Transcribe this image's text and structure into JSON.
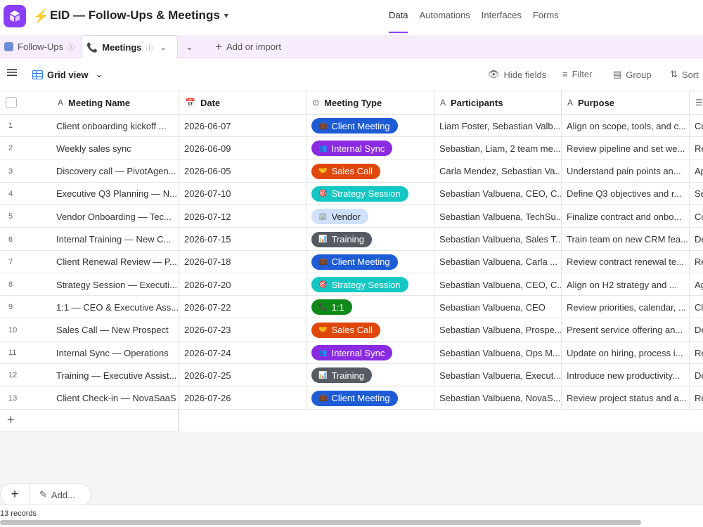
{
  "app": {
    "base_title": "EID — Follow-Ups & Meetings",
    "nav_tabs": [
      "Data",
      "Automations",
      "Interfaces",
      "Forms"
    ],
    "active_nav": "Data",
    "accent": "#8a3ffc"
  },
  "tables": {
    "items": [
      {
        "label": "Follow-Ups",
        "icon": "table-icon",
        "active": false
      },
      {
        "label": "Meetings",
        "icon": "phone-icon",
        "active": true
      }
    ],
    "add_label": "Add or import"
  },
  "toolbar": {
    "view_name": "Grid view",
    "hide_fields": "Hide fields",
    "filter": "Filter",
    "group": "Group",
    "sort": "Sort"
  },
  "columns": [
    {
      "label": "Meeting Name",
      "icon": "text-icon"
    },
    {
      "label": "Date",
      "icon": "calendar-icon"
    },
    {
      "label": "Meeting Type",
      "icon": "select-icon"
    },
    {
      "label": "Participants",
      "icon": "text-icon"
    },
    {
      "label": "Purpose",
      "icon": "text-icon"
    },
    {
      "label": "",
      "icon": "long-text-icon"
    }
  ],
  "meeting_types": {
    "Client Meeting": {
      "color": "#1e5cd6",
      "icon": "briefcase-icon",
      "glyph": "💼"
    },
    "Internal Sync": {
      "color": "#8a2be2",
      "icon": "people-icon",
      "glyph": "👥"
    },
    "Sales Call": {
      "color": "#e0470b",
      "icon": "handshake-icon",
      "glyph": "🤝"
    },
    "Strategy Session": {
      "color": "#14c7c2",
      "icon": "target-icon",
      "glyph": "🎯"
    },
    "Vendor": {
      "color": "#cfe0fb",
      "icon": "building-icon",
      "glyph": "🏢",
      "text_color": "#1d1f25"
    },
    "Training": {
      "color": "#555a63",
      "icon": "chart-icon",
      "glyph": "📊"
    },
    "1:1": {
      "color": "#0f8a19",
      "icon": "phone-icon",
      "glyph": "📞"
    }
  },
  "rows": [
    {
      "n": "1",
      "name": "Client onboarding kickoff ...",
      "date": "2026-06-07",
      "type": "Client Meeting",
      "participants": "Liam Foster, Sebastian Valb...",
      "purpose": "Align on scope, tools, and c...",
      "extra": "Co"
    },
    {
      "n": "2",
      "name": "Weekly sales sync",
      "date": "2026-06-09",
      "type": "Internal Sync",
      "participants": "Sebastian, Liam, 2 team me...",
      "purpose": "Review pipeline and set we...",
      "extra": "Re"
    },
    {
      "n": "3",
      "name": "Discovery call — PivotAgen...",
      "date": "2026-06-05",
      "type": "Sales Call",
      "participants": "Carla Mendez, Sebastian Va...",
      "purpose": "Understand pain points an...",
      "extra": "Ap"
    },
    {
      "n": "4",
      "name": "Executive Q3 Planning — N...",
      "date": "2026-07-10",
      "type": "Strategy Session",
      "participants": "Sebastian Valbuena, CEO, C...",
      "purpose": "Define Q3 objectives and r...",
      "extra": "Se"
    },
    {
      "n": "5",
      "name": "Vendor Onboarding — Tec...",
      "date": "2026-07-12",
      "type": "Vendor",
      "participants": "Sebastian Valbuena, TechSu...",
      "purpose": "Finalize contract and onbo...",
      "extra": "Co"
    },
    {
      "n": "6",
      "name": "Internal Training — New C...",
      "date": "2026-07-15",
      "type": "Training",
      "participants": "Sebastian Valbuena, Sales T...",
      "purpose": "Train team on new CRM fea...",
      "extra": "De"
    },
    {
      "n": "7",
      "name": "Client Renewal Review — P...",
      "date": "2026-07-18",
      "type": "Client Meeting",
      "participants": "Sebastian Valbuena, Carla ...",
      "purpose": "Review contract renewal te...",
      "extra": "Re"
    },
    {
      "n": "8",
      "name": "Strategy Session — Executi...",
      "date": "2026-07-20",
      "type": "Strategy Session",
      "participants": "Sebastian Valbuena, CEO, C...",
      "purpose": "Align on H2 strategy and ...",
      "extra": "Ag"
    },
    {
      "n": "9",
      "name": "1:1 — CEO & Executive Ass...",
      "date": "2026-07-22",
      "type": "1:1",
      "participants": "Sebastian Valbuena, CEO",
      "purpose": "Review priorities, calendar, ...",
      "extra": "Cla"
    },
    {
      "n": "10",
      "name": "Sales Call — New Prospect",
      "date": "2026-07-23",
      "type": "Sales Call",
      "participants": "Sebastian Valbuena, Prospe...",
      "purpose": "Present service offering an...",
      "extra": "De"
    },
    {
      "n": "11",
      "name": "Internal Sync — Operations",
      "date": "2026-07-24",
      "type": "Internal Sync",
      "participants": "Sebastian Valbuena, Ops M...",
      "purpose": "Update on hiring, process i...",
      "extra": "Re"
    },
    {
      "n": "12",
      "name": "Training — Executive Assist...",
      "date": "2026-07-25",
      "type": "Training",
      "participants": "Sebastian Valbuena, Execut...",
      "purpose": "Introduce new productivity...",
      "extra": "De"
    },
    {
      "n": "13",
      "name": "Client Check-in — NovaSaaS",
      "date": "2026-07-26",
      "type": "Client Meeting",
      "participants": "Sebastian Valbuena, NovaS...",
      "purpose": "Review project status and a...",
      "extra": "Re"
    }
  ],
  "footer": {
    "add_label": "Add...",
    "record_count": "13 records"
  }
}
